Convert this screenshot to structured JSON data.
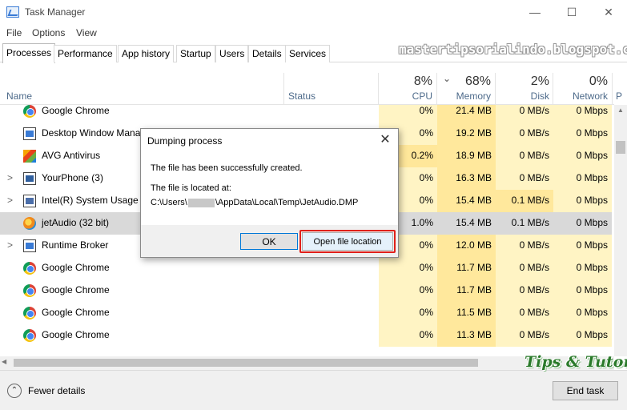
{
  "window": {
    "title": "Task Manager",
    "controls": {
      "minimize": "—",
      "maximize": "☐",
      "close": "✕"
    }
  },
  "menu": [
    "File",
    "Options",
    "View"
  ],
  "tabs": [
    "Processes",
    "Performance",
    "App history",
    "Startup",
    "Users",
    "Details",
    "Services"
  ],
  "active_tab": "Processes",
  "watermark": "mastertipsorialindo.blogspot.com",
  "columns": {
    "name": "Name",
    "status": "Status",
    "cpu": {
      "pct": "8%",
      "label": "CPU"
    },
    "memory": {
      "pct": "68%",
      "label": "Memory",
      "sort_indicator": "⌄"
    },
    "disk": {
      "pct": "2%",
      "label": "Disk"
    },
    "network": {
      "pct": "0%",
      "label": "Network"
    },
    "overflow": "P"
  },
  "processes": [
    {
      "name": "Google Chrome",
      "icon": "chrome-icon",
      "expand": "",
      "cpu": "0%",
      "memory": "21.4 MB",
      "disk": "0 MB/s",
      "network": "0 Mbps"
    },
    {
      "name": "Desktop Window Mana",
      "icon": "dwm-icon",
      "expand": "",
      "cpu": "0%",
      "memory": "19.2 MB",
      "disk": "0 MB/s",
      "network": "0 Mbps"
    },
    {
      "name": "AVG Antivirus",
      "icon": "avg-icon",
      "expand": "",
      "cpu": "0.2%",
      "memory": "18.9 MB",
      "disk": "0 MB/s",
      "network": "0 Mbps"
    },
    {
      "name": "YourPhone (3)",
      "icon": "phone-icon",
      "expand": ">",
      "cpu": "0%",
      "memory": "16.3 MB",
      "disk": "0 MB/s",
      "network": "0 Mbps"
    },
    {
      "name": "Intel(R) System Usage R",
      "icon": "intel-icon",
      "expand": ">",
      "cpu": "0%",
      "memory": "15.4 MB",
      "disk": "0.1 MB/s",
      "network": "0 Mbps"
    },
    {
      "name": "jetAudio (32 bit)",
      "icon": "jetaudio-icon",
      "expand": "",
      "cpu": "1.0%",
      "memory": "15.4 MB",
      "disk": "0.1 MB/s",
      "network": "0 Mbps"
    },
    {
      "name": "Runtime Broker",
      "icon": "runtime-broker-icon",
      "expand": ">",
      "cpu": "0%",
      "memory": "12.0 MB",
      "disk": "0 MB/s",
      "network": "0 Mbps"
    },
    {
      "name": "Google Chrome",
      "icon": "chrome-icon",
      "expand": "",
      "cpu": "0%",
      "memory": "11.7 MB",
      "disk": "0 MB/s",
      "network": "0 Mbps"
    },
    {
      "name": "Google Chrome",
      "icon": "chrome-icon",
      "expand": "",
      "cpu": "0%",
      "memory": "11.7 MB",
      "disk": "0 MB/s",
      "network": "0 Mbps"
    },
    {
      "name": "Google Chrome",
      "icon": "chrome-icon",
      "expand": "",
      "cpu": "0%",
      "memory": "11.5 MB",
      "disk": "0 MB/s",
      "network": "0 Mbps"
    },
    {
      "name": "Google Chrome",
      "icon": "chrome-icon",
      "expand": "",
      "cpu": "0%",
      "memory": "11.3 MB",
      "disk": "0 MB/s",
      "network": "0 Mbps"
    }
  ],
  "selected_process": "jetAudio (32 bit)",
  "colors": {
    "cpu_heat": "#fff4c4",
    "cpu_heat_strong": "#ffe79a",
    "mem_heat": "#ffe89c",
    "disk_heat": "#fff4c4",
    "net_heat": "#fff4c4",
    "selected_row": "#d9d9d9",
    "highlight_border": "#e0201a",
    "accent": "#0078d7"
  },
  "footer": {
    "fewer_details": "Fewer details",
    "end_task": "End task",
    "logo_text": "Tips & Tutorial"
  },
  "dialog": {
    "title": "Dumping process",
    "close": "✕",
    "message": "The file has been successfully created.",
    "location_label": "The file is located at:",
    "path_prefix": "C:\\Users\\",
    "path_suffix": "\\AppData\\Local\\Temp\\JetAudio.DMP",
    "ok_label": "OK",
    "open_location_label": "Open file location"
  }
}
